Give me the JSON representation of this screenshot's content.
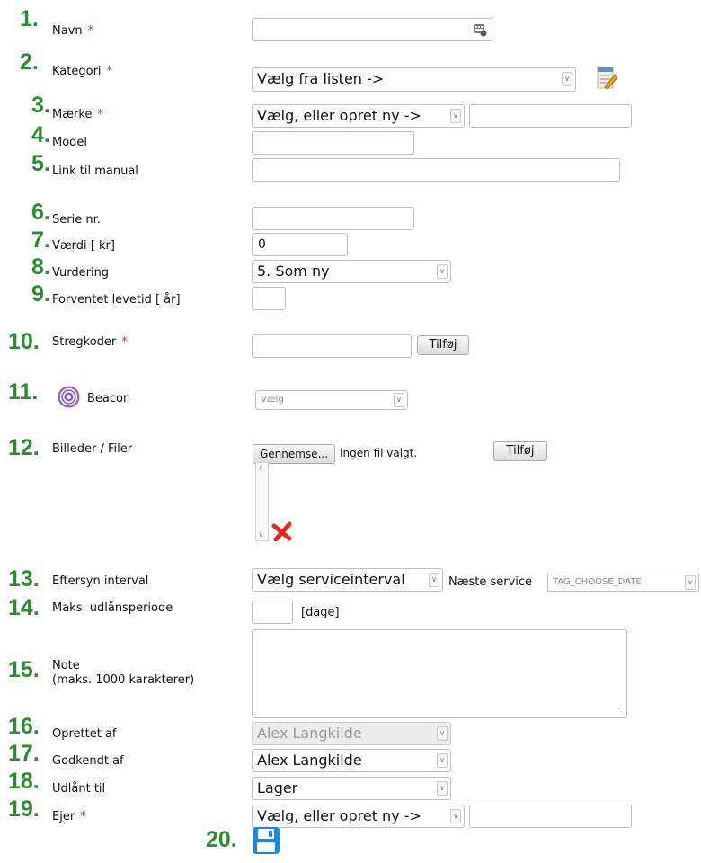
{
  "numbers": [
    "1.",
    "2.",
    "3.",
    "4.",
    "5.",
    "6.",
    "7.",
    "8.",
    "9.",
    "10.",
    "11.",
    "12.",
    "13.",
    "14.",
    "15.",
    "16.",
    "17.",
    "18.",
    "19.",
    "20."
  ],
  "labels": {
    "navn": "Navn",
    "kategori": "Kategori",
    "maerke": "Mærke",
    "model": "Model",
    "link": "Link til manual",
    "serie": "Serie nr.",
    "vaerdi": "Værdi [ kr]",
    "vurdering": "Vurdering",
    "levetid": "Forventet levetid  [ år]",
    "stregkoder": "Stregkoder",
    "beacon": "Beacon",
    "billeder": "Billeder /  Filer",
    "eftersyn": "Eftersyn interval",
    "udlaan": "Maks. udlånsperiode",
    "note": "Note",
    "note_sub": "(maks. 1000 karakterer)",
    "oprettet": "Oprettet af",
    "godkendt": "Godkendt af",
    "udlaant": "Udlånt til",
    "ejer": "Ejer"
  },
  "required_mark": "*",
  "fields": {
    "kategori_select": "Vælg fra listen ->",
    "maerke_select": "Vælg, eller opret ny ->",
    "vaerdi_value": "0",
    "vurdering_select": "5. Som ny",
    "beacon_select": "Vælg",
    "eftersyn_select": "Vælg serviceinterval",
    "naeste_service_label": "Næste service",
    "naeste_service_select": "TAG_CHOOSE_DATE",
    "udlaan_unit": "[dage]",
    "oprettet_select": "Alex Langkilde",
    "godkendt_select": "Alex Langkilde",
    "udlaant_select": "Lager",
    "ejer_select": "Vælg, eller opret ny ->"
  },
  "buttons": {
    "tilfoj": "Tilføj",
    "tilfoj_files": "Tilføj",
    "gennemse": "Gennemse...",
    "ingen_fil": "Ingen fil valgt."
  },
  "colors": {
    "number_green": "#2e8b33",
    "required_red": "#c0392b"
  }
}
